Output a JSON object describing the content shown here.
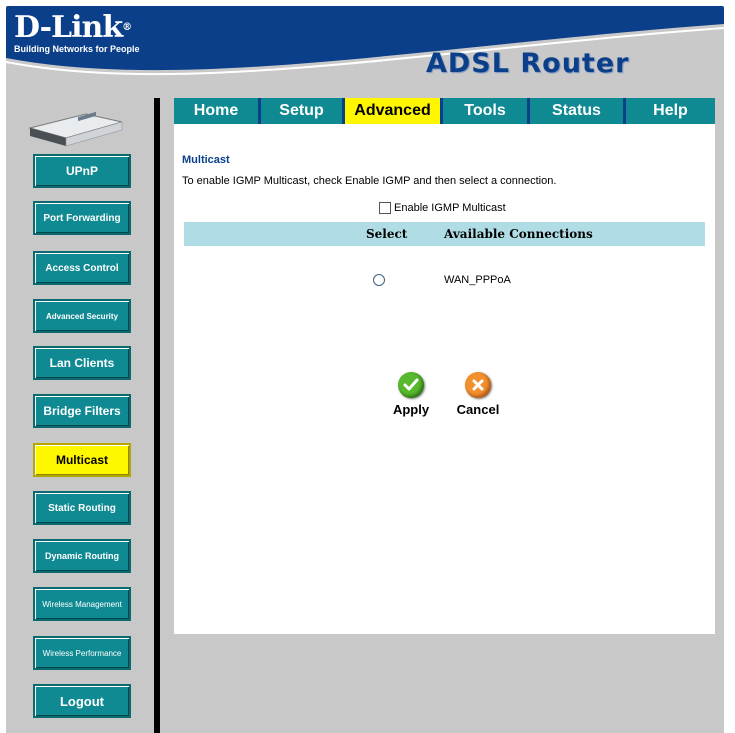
{
  "header": {
    "brand": "D-Link",
    "registered_mark": "®",
    "tagline": "Building Networks for People",
    "product_title": "ADSL Router",
    "bg_color": "#0c3f8a"
  },
  "sidebar": {
    "items": [
      {
        "label": "UPnP",
        "active": false
      },
      {
        "label": "Port Forwarding",
        "active": false
      },
      {
        "label": "Access Control",
        "active": false
      },
      {
        "label": "Advanced Security",
        "active": false
      },
      {
        "label": "Lan Clients",
        "active": false
      },
      {
        "label": "Bridge Filters",
        "active": false
      },
      {
        "label": "Multicast",
        "active": true
      },
      {
        "label": "Static Routing",
        "active": false
      },
      {
        "label": "Dynamic Routing",
        "active": false
      },
      {
        "label": "Wireless Management",
        "active": false
      },
      {
        "label": "Wireless Performance",
        "active": false
      },
      {
        "label": "Logout",
        "active": false
      }
    ],
    "button_color": "#0f8a92",
    "active_color": "#fff700"
  },
  "tabs": [
    {
      "label": "Home",
      "active": false
    },
    {
      "label": "Setup",
      "active": false
    },
    {
      "label": "Advanced",
      "active": true
    },
    {
      "label": "Tools",
      "active": false
    },
    {
      "label": "Status",
      "active": false
    },
    {
      "label": "Help",
      "active": false
    }
  ],
  "main": {
    "section_title": "Multicast",
    "description": "To enable IGMP Multicast, check Enable IGMP and then select a connection.",
    "enable_igmp_label": "Enable IGMP Multicast",
    "enable_igmp_checked": false,
    "table": {
      "columns": [
        "Select",
        "Available Connections"
      ],
      "rows": [
        {
          "connection": "WAN_PPPoA",
          "selected": false
        }
      ],
      "header_color": "#b0dde5"
    },
    "apply_label": "Apply",
    "cancel_label": "Cancel"
  }
}
